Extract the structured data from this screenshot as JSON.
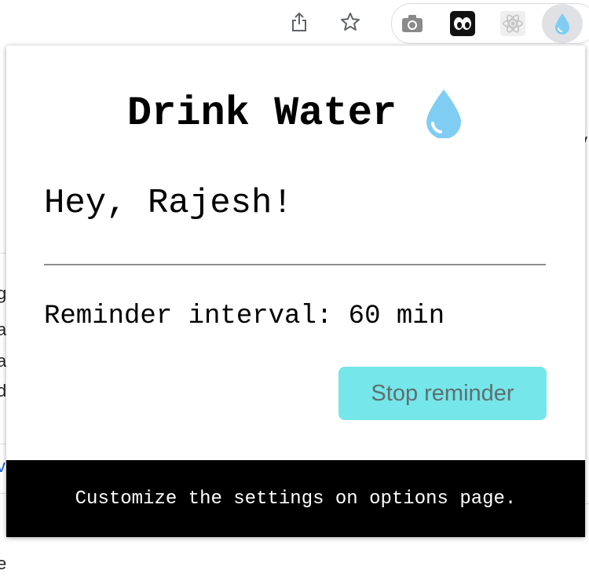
{
  "toolbar": {
    "share_icon": "share-icon",
    "star_icon": "bookmark-star-icon",
    "extensions": [
      {
        "name": "camera-extension-icon"
      },
      {
        "name": "eyes-extension-icon"
      },
      {
        "name": "react-devtools-extension-icon"
      },
      {
        "name": "water-drop-extension-icon"
      }
    ]
  },
  "popup": {
    "title": "Drink Water",
    "title_icon": "water-drop-icon",
    "greeting": "Hey, Rajesh!",
    "interval_label": "Reminder interval:",
    "interval_value": "60",
    "interval_unit": "min",
    "stop_button_label": "Stop reminder",
    "footer_text": "Customize the settings on options page."
  },
  "colors": {
    "stop_button_bg": "#75e6ea",
    "footer_bg": "#000000",
    "drop_blue": "#7fcdf3"
  },
  "under_page": {
    "left_chars": [
      "g",
      "a",
      "ai",
      "d",
      "v",
      "e"
    ],
    "right_char": "y"
  }
}
